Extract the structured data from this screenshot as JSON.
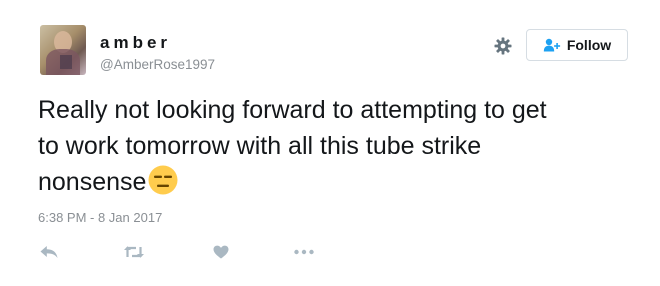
{
  "tweet": {
    "author_name": "amber",
    "author_handle": "@AmberRose1997",
    "follow_label": "Follow",
    "text_lines": [
      "Really not looking forward to attempting to get",
      "to work tomorrow with all this tube strike",
      "nonsense"
    ],
    "emoji": "expressionless-face",
    "timestamp": "6:38 PM - 8 Jan 2017"
  },
  "icons": {
    "settings": "gear-icon",
    "follow": "add-person-icon",
    "reply": "reply-icon",
    "retweet": "retweet-icon",
    "like": "heart-icon",
    "more": "more-icon"
  },
  "colors": {
    "text": "#14171a",
    "muted": "#8a8f94",
    "icon": "#aab8c2",
    "follow_accent": "#1da1f2",
    "emoji": "#ffcc4d"
  }
}
